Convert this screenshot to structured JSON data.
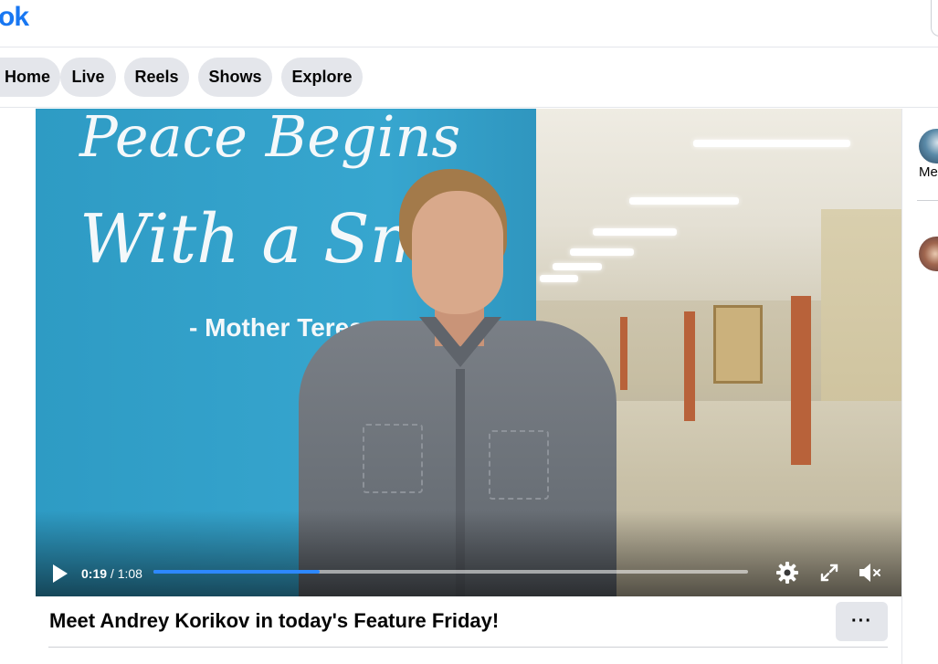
{
  "header": {
    "logo_text": "ok",
    "brand_color": "#1877f2"
  },
  "tabs": [
    {
      "label": "Home"
    },
    {
      "label": "Live"
    },
    {
      "label": "Reels"
    },
    {
      "label": "Shows"
    },
    {
      "label": "Explore"
    }
  ],
  "video": {
    "banner_line1": "Peace Begins",
    "banner_line2": "With a Smi",
    "banner_line3": "- Mother Teresa",
    "current_time": "0:19",
    "separator": " / ",
    "duration": "1:08",
    "progress_fraction": 0.2794,
    "progress_color": "#2d88ff",
    "icons": {
      "play": "play-icon",
      "settings": "gear-icon",
      "fullscreen": "fullscreen-icon",
      "mute": "volume-muted-icon"
    }
  },
  "post": {
    "title": "Meet Andrey Korikov in today's Feature Friday!",
    "more_label": "···"
  },
  "sidebar": {
    "item1_text": "Me"
  }
}
